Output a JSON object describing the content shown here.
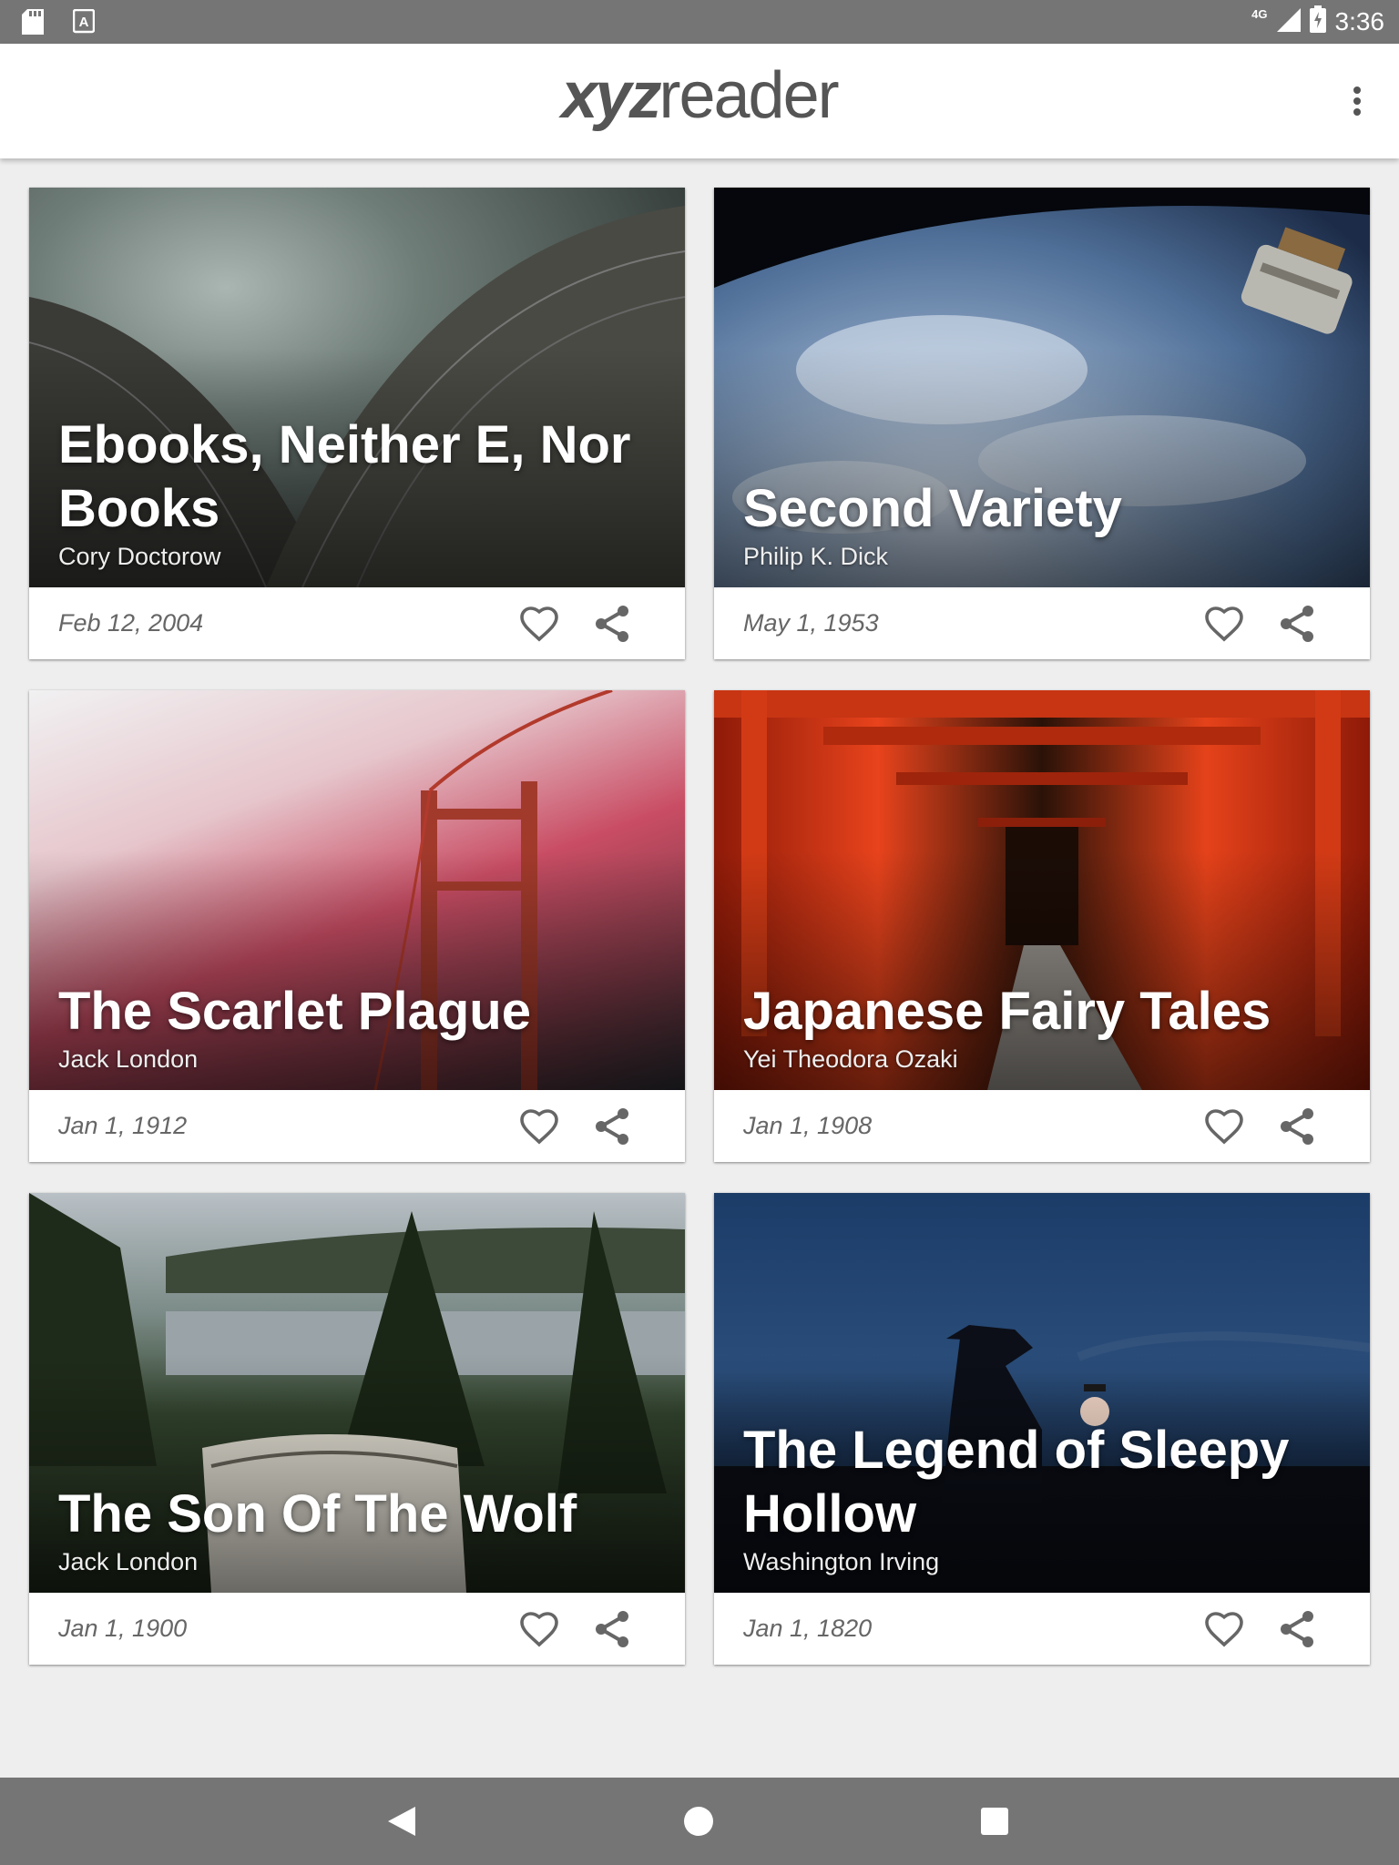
{
  "status_bar": {
    "time": "3:36",
    "network": "4G",
    "icons": [
      "sd-card-icon",
      "text-a-icon",
      "signal-icon",
      "battery-charging-icon"
    ]
  },
  "app_bar": {
    "logo_bold": "xyz",
    "logo_light": "reader",
    "overflow_icon": "more-vert-icon"
  },
  "articles": [
    {
      "title": "Ebooks, Neither E, Nor Books",
      "author": "Cory Doctorow",
      "date": "Feb 12, 2004",
      "image": "opera-house-roof"
    },
    {
      "title": "Second Variety",
      "author": "Philip K. Dick",
      "date": "May 1, 1953",
      "image": "earth-from-space"
    },
    {
      "title": "The Scarlet Plague",
      "author": "Jack London",
      "date": "Jan 1, 1912",
      "image": "bridge-in-red-fog"
    },
    {
      "title": "Japanese Fairy Tales",
      "author": "Yei Theodora Ozaki",
      "date": "Jan 1, 1908",
      "image": "torii-gates"
    },
    {
      "title": "The Son Of The Wolf",
      "author": "Jack London",
      "date": "Jan 1, 1900",
      "image": "lake-forest-mug"
    },
    {
      "title": "The Legend of Sleepy Hollow",
      "author": "Washington Irving",
      "date": "Jan 1, 1820",
      "image": "lantern-silhouette-night"
    }
  ],
  "card_actions": {
    "favorite_icon": "heart-outline-icon",
    "share_icon": "share-icon"
  },
  "nav_bar": {
    "back_icon": "back-triangle-icon",
    "home_icon": "home-circle-icon",
    "recents_icon": "recents-square-icon"
  },
  "colors": {
    "status_bar": "#757575",
    "app_bar": "#ffffff",
    "background": "#eeeeee",
    "icon": "#666666"
  }
}
